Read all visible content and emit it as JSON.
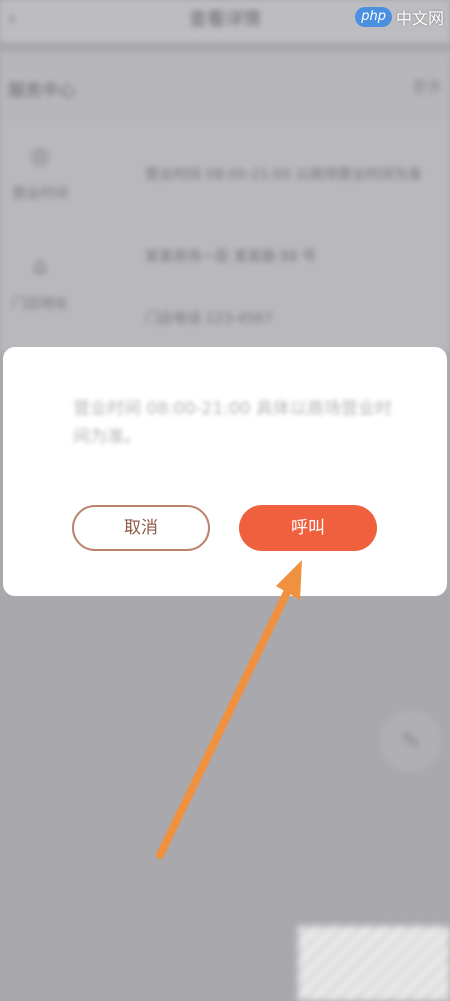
{
  "background": {
    "header_title": "查看详情",
    "section_title": "服务中心",
    "section_right": "更多",
    "rows": [
      {
        "label": "营业时间",
        "text": "营业时间 08:00-21:00 以商场营业时间为准"
      },
      {
        "label": "门店地址",
        "text": "某某商场一层 某某路 88 号"
      },
      {
        "label": "",
        "text": "门店电话 123-4567"
      }
    ]
  },
  "dialog": {
    "message": "营业时间 08:00-21:00 具体以商场营业时间为准。",
    "cancel_label": "取消",
    "call_label": "呼叫"
  },
  "watermark": {
    "php": "php",
    "site": "中文网"
  },
  "colors": {
    "accent": "#f0603f",
    "cancel_border": "#b9836e",
    "arrow": "#f0913f"
  }
}
